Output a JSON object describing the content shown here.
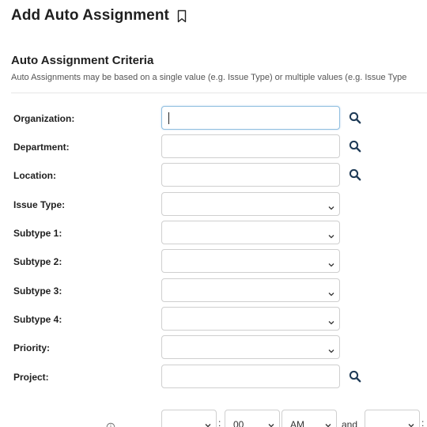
{
  "page": {
    "title": "Add Auto Assignment"
  },
  "criteria": {
    "title": "Auto Assignment Criteria",
    "description": "Auto Assignments may be based on a single value (e.g. Issue Type) or multiple values (e.g. Issue Type"
  },
  "fields": {
    "organization": {
      "label": "Organization:",
      "value": ""
    },
    "department": {
      "label": "Department:",
      "value": ""
    },
    "location": {
      "label": "Location:",
      "value": ""
    },
    "issue_type": {
      "label": "Issue Type:",
      "value": ""
    },
    "subtype1": {
      "label": "Subtype 1:",
      "value": ""
    },
    "subtype2": {
      "label": "Subtype 2:",
      "value": ""
    },
    "subtype3": {
      "label": "Subtype 3:",
      "value": ""
    },
    "subtype4": {
      "label": "Subtype 4:",
      "value": ""
    },
    "priority": {
      "label": "Priority:",
      "value": ""
    },
    "project": {
      "label": "Project:",
      "value": ""
    }
  },
  "time_range": {
    "minute_value": "00",
    "ampm_value": "AM",
    "and_text": "and",
    "colon": ":"
  },
  "icons": {
    "search": "search-icon",
    "dropdown": "chevron-down-icon",
    "bookmark": "bookmark-icon",
    "info": "info-icon"
  },
  "colors": {
    "focus_border": "#90bfe0",
    "field_border": "#cfcfcf",
    "icon": "#1f3b57"
  }
}
